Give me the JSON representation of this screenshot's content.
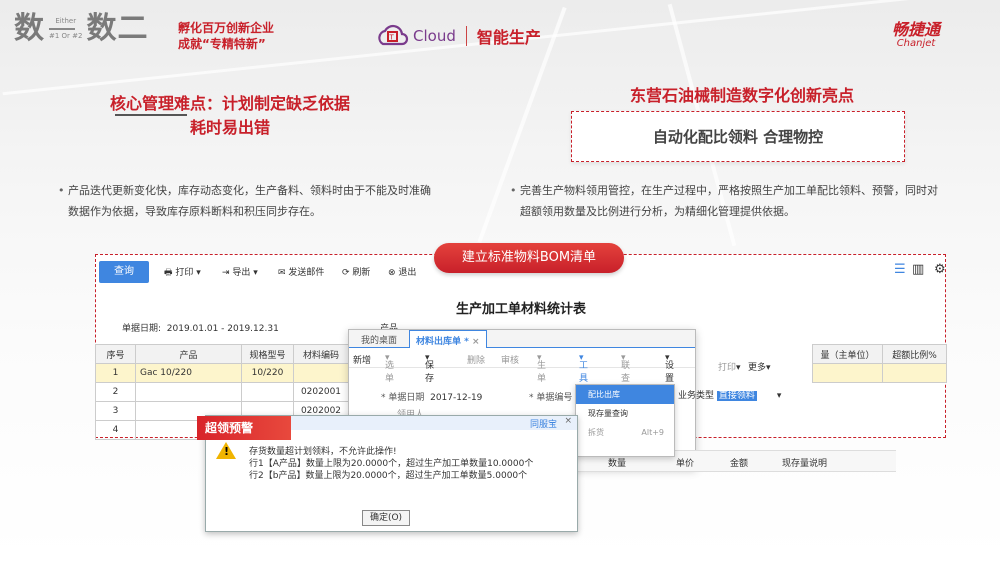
{
  "header": {
    "brand_left_1": "数",
    "brand_left_2": "数二",
    "either": "Either",
    "or": "#1 Or #2",
    "slogan_line1": "孵化百万创新企业",
    "slogan_line2": "成就“专精特新”",
    "cloud_text": "Cloud",
    "cloud_title": "智能生产",
    "chanjet_cn": "畅捷通",
    "chanjet_en": "Chanjet"
  },
  "left": {
    "pain_title_1": "核心管理难点：计划制定缺乏依据",
    "pain_title_2": "耗时易出错",
    "para": "产品迭代更新变化快，库存动态变化，生产备料、领料时由于不能及时准确数据作为依据，导致库存原料断料和积压同步存在。",
    "para_line1": "产品迭代更新变化快，库存动态变化，生产备料、领料时由于不能及时准确",
    "para_line2": "数据作为依据，导致库存原料断料和积压同步存在。"
  },
  "right": {
    "title": "东营石油械制造数字化创新亮点",
    "box": "自动化配比领料   合理物控",
    "para_line1": "完善生产物料领用管控，在生产过程中，严格按照生产加工单配比领料、预警，同时对",
    "para_line2": "超额领用数量及比例进行分析，为精细化管理提供依据。"
  },
  "bom_pill": "建立标准物料BOM清单",
  "toolbar": {
    "query": "查询",
    "print": "打印",
    "export": "导出",
    "send": "发送邮件",
    "refresh": "刷新",
    "exit": "退出"
  },
  "report": {
    "title": "生产加工单材料统计表",
    "date_label": "单据日期:",
    "date_value": "2019.01.01 - 2019.12.31",
    "product_label": "产品"
  },
  "grid": {
    "headers": [
      "序号",
      "产品",
      "规格型号",
      "材料编码"
    ],
    "rows": [
      [
        "1",
        "Gac 10/220",
        "10/220",
        ""
      ],
      [
        "2",
        "",
        "",
        "0202001"
      ],
      [
        "3",
        "",
        "",
        "0202002"
      ],
      [
        "4",
        "",
        "",
        ""
      ]
    ],
    "right_headers": [
      "量（主单位）",
      "超额比例%"
    ]
  },
  "popup": {
    "tab_home": "我的桌面",
    "tab_active": "材料出库单 *",
    "menu": [
      "新增",
      "选单",
      "保存",
      "删除",
      "审核",
      "生单",
      "工具",
      "联查",
      "设置",
      "打印",
      "更多"
    ],
    "date_label": "* 单据日期",
    "date_value": "2017-12-19",
    "docno_label": "* 单据编号",
    "biz_type_label": "业务类型",
    "biz_type_value": "直接领料",
    "sub_headers": [
      "数量",
      "单价",
      "金额",
      "现存量说明"
    ],
    "row_hint": "领用人"
  },
  "dropdown": {
    "items": [
      "配比出库",
      "现存量查询",
      "拆货"
    ],
    "shortcut": "Alt+9"
  },
  "alert": {
    "badge": "超领预警",
    "brand": "同服宝",
    "lines": [
      "存货数量超计划领料，不允许此操作!",
      "行1【A产品】数量上限为20.0000个，超过生产加工单数量10.0000个",
      "行2【b产品】数量上限为20.0000个，超过生产加工单数量5.0000个"
    ],
    "ok": "确定(O)"
  }
}
